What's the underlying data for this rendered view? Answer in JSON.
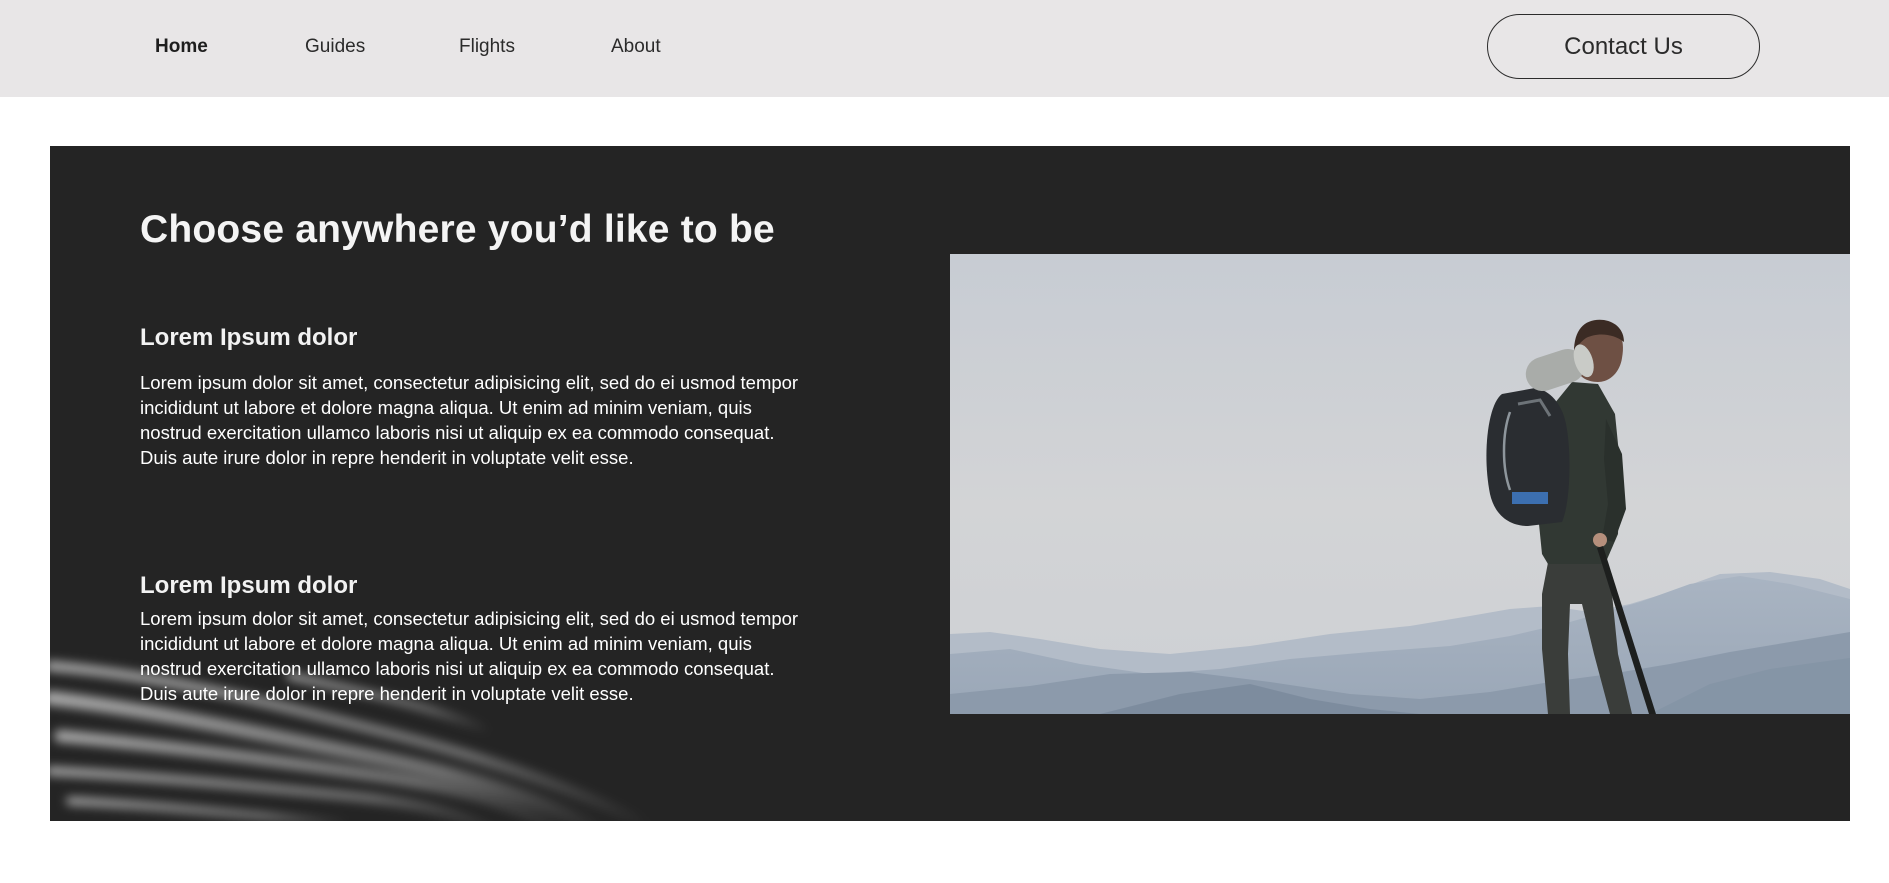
{
  "nav": {
    "items": [
      {
        "label": "Home",
        "active": true
      },
      {
        "label": "Guides",
        "active": false
      },
      {
        "label": "Flights",
        "active": false
      },
      {
        "label": "About",
        "active": false
      }
    ],
    "contact_label": "Contact Us"
  },
  "hero": {
    "title": "Choose anywhere you’d like to be",
    "features": [
      {
        "heading": "Lorem Ipsum dolor",
        "body": "Lorem ipsum dolor sit amet, consectetur adipisicing elit, sed do ei usmod tempor incididunt ut labore et dolore magna aliqua. Ut enim ad minim veniam, quis nostrud exercitation ullamco laboris nisi ut aliquip ex ea commodo consequat. Duis aute irure dolor in repre henderit in voluptate velit esse."
      },
      {
        "heading": "Lorem Ipsum dolor",
        "body": "Lorem ipsum dolor sit amet, consectetur adipisicing elit, sed do ei usmod tempor incididunt ut labore et dolore magna aliqua. Ut enim ad minim veniam, quis nostrud exercitation ullamco laboris nisi ut aliquip ex ea commodo consequat. Duis aute irure dolor in repre henderit in voluptate velit esse."
      }
    ],
    "photo_icon": "hiker-mountain-photo"
  },
  "colors": {
    "topbar_bg": "#e8e6e7",
    "hero_bg": "#242424",
    "text_light": "#ffffff",
    "text_dark": "#2b2b2b"
  }
}
